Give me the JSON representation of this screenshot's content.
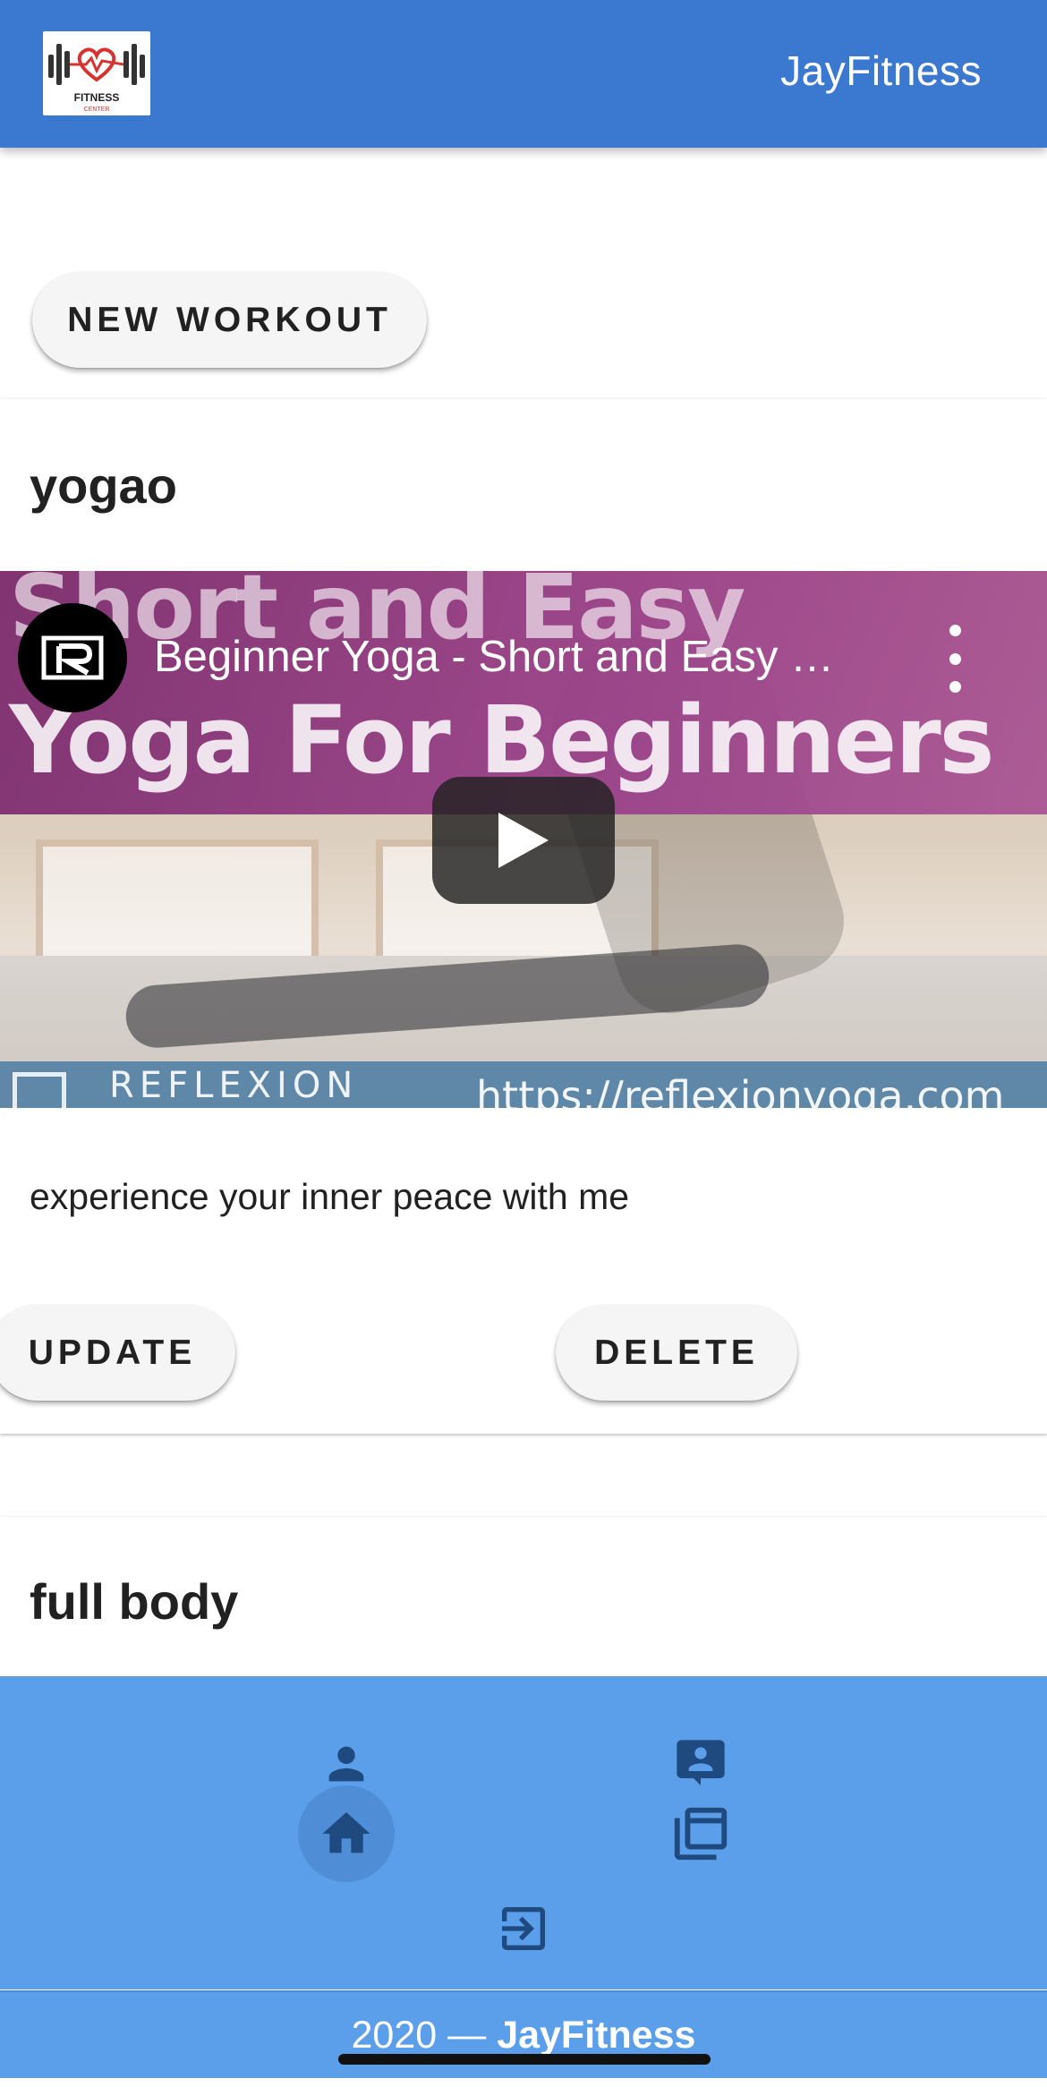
{
  "header": {
    "logo": {
      "icon": "heartbeat-dumbbell-logo",
      "text": "FITNESS",
      "subtext": "CENTER"
    },
    "title": "JayFitness"
  },
  "actions": {
    "new_workout_label": "NEW WORKOUT"
  },
  "workouts": [
    {
      "title": "yogao",
      "video": {
        "title": "Beginner Yoga - Short and Easy …",
        "overlay_line_1": "Short and Easy",
        "overlay_line_2": "Yoga For Beginners",
        "brand": "REFLEXION",
        "url": "https://reflexionyoga.com",
        "icons": {
          "channel": "reflexion-channel-icon",
          "menu": "more-vert-icon",
          "play": "youtube-play-icon"
        }
      },
      "description": "experience your inner peace with me",
      "update_label": "UPDATE",
      "delete_label": "DELETE"
    },
    {
      "title": "full body"
    }
  ],
  "bottom_nav": {
    "items": [
      {
        "icon": "person-icon",
        "active": false
      },
      {
        "icon": "feedback-icon",
        "active": false
      },
      {
        "icon": "home-icon",
        "active": true
      },
      {
        "icon": "video-library-icon",
        "active": false
      },
      {
        "icon": "logout-icon",
        "active": false
      }
    ]
  },
  "footer": {
    "year": "2020",
    "separator": "—",
    "brand": "JayFitness"
  },
  "colors": {
    "appbar": "#3b78cf",
    "bottom_nav": "#5b9ee9",
    "nav_icon": "#1f4a80",
    "button_bg": "#f5f5f5"
  }
}
